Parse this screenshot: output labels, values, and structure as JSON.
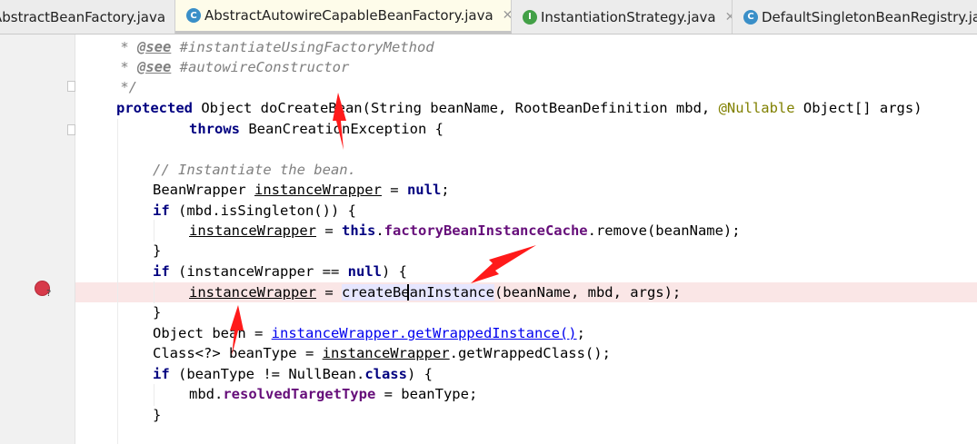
{
  "tabs": [
    {
      "label": "AbstractBeanFactory.java",
      "icon": "",
      "close": "✕",
      "active": false
    },
    {
      "label": "AbstractAutowireCapableBeanFactory.java",
      "icon": "C",
      "close": "✕",
      "active": true
    },
    {
      "label": "InstantiationStrategy.java",
      "icon": "I",
      "close": "✕",
      "active": false
    },
    {
      "label": "DefaultSingletonBeanRegistry.java",
      "icon": "C",
      "close": "",
      "active": false
    }
  ],
  "colors": {
    "class_icon": "#3a8fc8",
    "interface_icon": "#43a047",
    "breakpoint": "#d73a4a",
    "annotation_arrow": "#ff1a1a",
    "highlight_line": "#fae6e6"
  },
  "gutter": {
    "breakpoint_icon": "breakpoint-icon",
    "breakpoint_mark": "?"
  },
  "code": {
    "l1": {
      "a": " * ",
      "b": "@see",
      "c": " #instantiateUsingFactoryMethod"
    },
    "l2": {
      "a": " * ",
      "b": "@see",
      "c": " #autowireConstructor"
    },
    "l3": {
      "a": " */"
    },
    "l4": {
      "a": "protected",
      "b": " Object doCreateBean(String beanName, RootBeanDefinition mbd, ",
      "c": "@Nullable",
      "d": " Object[] args)"
    },
    "l5": {
      "a": "throws",
      "b": " BeanCreationException {"
    },
    "l6": {
      "a": "// Instantiate the bean."
    },
    "l7": {
      "a": "BeanWrapper ",
      "b": "instanceWrapper",
      "c": " = ",
      "d": "null",
      "e": ";"
    },
    "l8": {
      "a": "if",
      "b": " (mbd.isSingleton()) {"
    },
    "l9": {
      "a": "instanceWrapper",
      "b": " = ",
      "c": "this",
      "d": ".",
      "e": "factoryBeanInstanceCache",
      "f": ".remove(beanName);"
    },
    "l10": {
      "a": "}"
    },
    "l11": {
      "a": "if",
      "b": " (",
      "c": "instanceWrapper",
      "d": " == ",
      "e": "null",
      "f": ") {"
    },
    "l12": {
      "a": "instanceWrapper",
      "b": " = ",
      "c": "createBeanInstance",
      "d": "(beanName, mbd, args);"
    },
    "l13": {
      "a": "}"
    },
    "l14": {
      "a": "Object bean = ",
      "b": "instanceWrapper.getWrappedInstance()",
      "c": ";"
    },
    "l15": {
      "a": "Class<?> beanType = ",
      "b": "instanceWrapper",
      "c": ".getWrappedClass();"
    },
    "l16": {
      "a": "if",
      "b": " (beanType != NullBean.",
      "c": "class",
      "d": ") {"
    },
    "l17": {
      "a": "mbd.",
      "b": "resolvedTargetType",
      "c": " = beanType;"
    },
    "l18": {
      "a": "}"
    }
  }
}
